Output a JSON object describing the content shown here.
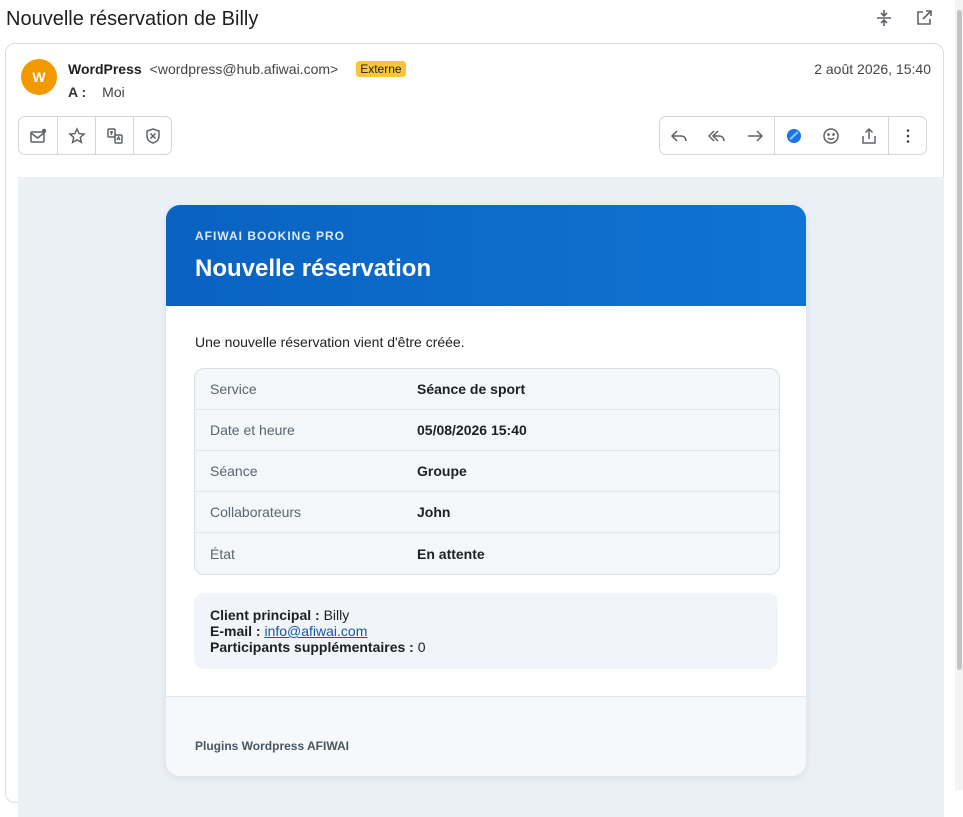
{
  "subject": "Nouvelle réservation de Billy",
  "sender": {
    "avatar_letter": "W",
    "name": "WordPress",
    "email": "<wordpress@hub.afiwai.com>",
    "badge": "Externe",
    "to_label": "A :",
    "to_value": "Moi",
    "date": "2 août 2026, 15:40"
  },
  "icons": {
    "collapse": "collapse-icon",
    "popout": "open-external-icon",
    "left_tools": [
      "mark-unread-icon",
      "star-icon",
      "translate-icon",
      "shield-icon"
    ],
    "right_tools": [
      "reply-icon",
      "reply-all-icon",
      "forward-icon",
      "copilot-icon",
      "emoji-icon",
      "share-icon",
      "more-icon"
    ]
  },
  "email": {
    "brand": "AFIWAI BOOKING PRO",
    "title": "Nouvelle réservation",
    "intro": "Une nouvelle réservation vient d'être créée.",
    "details": [
      {
        "key": "Service",
        "value": "Séance de sport"
      },
      {
        "key": "Date et heure",
        "value": "05/08/2026 15:40"
      },
      {
        "key": "Séance",
        "value": "Groupe"
      },
      {
        "key": "Collaborateurs",
        "value": "John"
      },
      {
        "key": "État",
        "value": "En attente"
      }
    ],
    "client": {
      "main_label": "Client principal :",
      "main_value": "Billy",
      "email_label": "E-mail :",
      "email_value": "info@afiwai.com",
      "extra_label": "Participants supplémentaires :",
      "extra_value": "0"
    },
    "footer": "Plugins Wordpress AFIWAI"
  },
  "colors": {
    "header_blue": "#0a62c2",
    "avatar": "#f29900",
    "badge": "#f9c53a",
    "body_bg": "#eaf0f6"
  }
}
